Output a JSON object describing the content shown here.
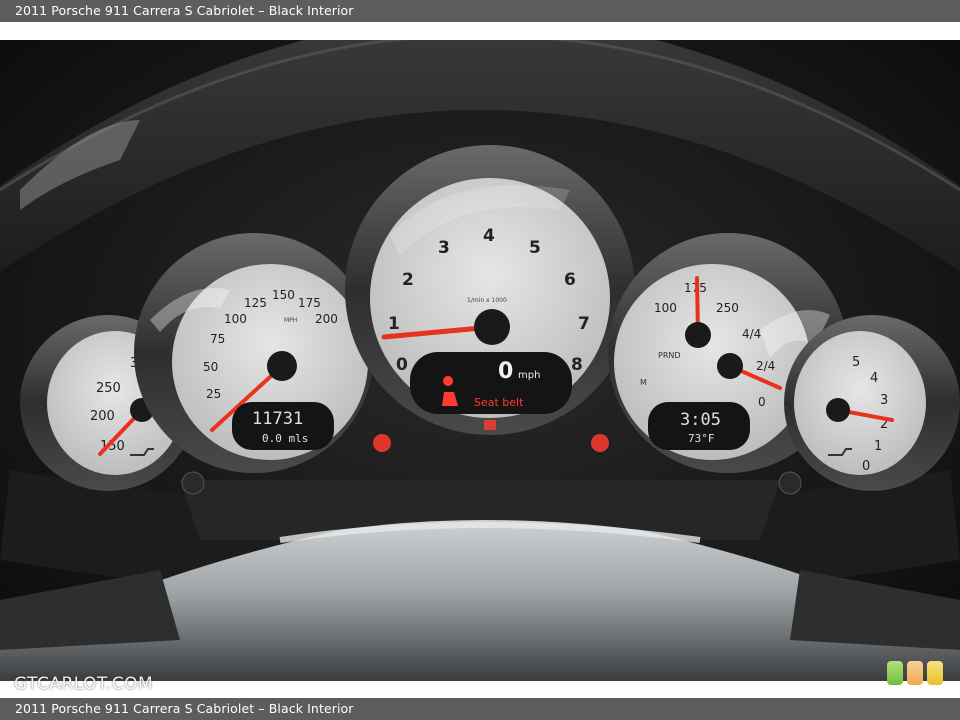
{
  "caption": {
    "top": "2011 Porsche 911 Carrera S Cabriolet – Black Interior",
    "bottom": "2011 Porsche 911 Carrera S Cabriolet – Black Interior"
  },
  "watermark": "GTCARLOT.COM",
  "tach": {
    "numbers": [
      "0",
      "1",
      "2",
      "3",
      "4",
      "5",
      "6",
      "7",
      "8"
    ],
    "unit": "1/min x 1000",
    "needle": 0.8
  },
  "speedo": {
    "numbers": [
      "25",
      "50",
      "75",
      "100",
      "125",
      "150",
      "175",
      "200"
    ],
    "unit": "MPH",
    "odometer": "11731",
    "trip": "0.0 mls",
    "needle": 0
  },
  "display": {
    "speed": "0",
    "speed_unit": "mph",
    "warning": "Seat belt"
  },
  "right_gauge": {
    "numbers": [
      "100",
      "175",
      "250",
      "4/4",
      "2/4",
      "0"
    ],
    "clock": "3:05",
    "temp": "73°F",
    "gears": "PRND",
    "gear_m": "M"
  },
  "left_gauge": {
    "numbers": [
      "300",
      "250",
      "200",
      "150"
    ]
  },
  "far_right_gauge": {
    "numbers": [
      "5",
      "4",
      "3",
      "2",
      "1",
      "0"
    ]
  },
  "colors": {
    "needle": "#e8321e",
    "led_red": "#ff3b30",
    "dial_face": "#dcdcdc"
  }
}
